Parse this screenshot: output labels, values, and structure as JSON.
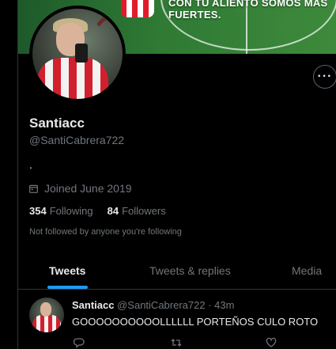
{
  "banner": {
    "text": "CON TU ALIENTO SOMOS MAS FUERTES."
  },
  "profile": {
    "name": "Santiacc",
    "handle": "@SantiCabrera722",
    "bio": ".",
    "joined": "Joined June 2019",
    "following_count": "354",
    "following_label": "Following",
    "followers_count": "84",
    "followers_label": "Followers",
    "not_followed": "Not followed by anyone you're following"
  },
  "tabs": [
    {
      "label": "Tweets",
      "active": true
    },
    {
      "label": "Tweets & replies",
      "active": false
    },
    {
      "label": "Media",
      "active": false
    }
  ],
  "tweet": {
    "author": "Santiacc",
    "meta": "@SantiCabrera722 · 43m",
    "text": "GOOOOOOOOOOLLLLLL PORTEÑOS CULO ROTO"
  },
  "icons": {
    "more": "more-icon",
    "calendar": "calendar-icon",
    "reply": "reply-icon",
    "retweet": "retweet-icon",
    "like": "like-icon"
  },
  "colors": {
    "accent": "#1d9bf0",
    "background": "#000000",
    "muted": "#71767b"
  }
}
